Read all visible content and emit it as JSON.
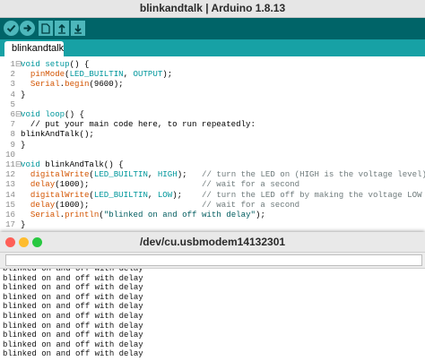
{
  "ide": {
    "title": "blinkandtalk | Arduino 1.8.13",
    "toolbar": {
      "verify_icon": "checkmark-icon",
      "upload_icon": "right-arrow-icon",
      "new_icon": "new-file-icon",
      "open_icon": "open-up-arrow-icon",
      "save_icon": "save-down-arrow-icon"
    },
    "tab_label": "blinkandtalk",
    "code_lines": [
      {
        "num": "1",
        "fold": "⊟",
        "tokens": [
          {
            "t": "void",
            "c": "kw"
          },
          {
            "t": " ",
            "c": "pl"
          },
          {
            "t": "setup",
            "c": "kw"
          },
          {
            "t": "() {",
            "c": "pl"
          }
        ]
      },
      {
        "num": "2",
        "fold": "",
        "tokens": [
          {
            "t": "  ",
            "c": "pl"
          },
          {
            "t": "pinMode",
            "c": "fn"
          },
          {
            "t": "(",
            "c": "pl"
          },
          {
            "t": "LED_BUILTIN",
            "c": "kw"
          },
          {
            "t": ", ",
            "c": "pl"
          },
          {
            "t": "OUTPUT",
            "c": "kw"
          },
          {
            "t": ");",
            "c": "pl"
          }
        ]
      },
      {
        "num": "3",
        "fold": "",
        "tokens": [
          {
            "t": "  ",
            "c": "pl"
          },
          {
            "t": "Serial",
            "c": "fn"
          },
          {
            "t": ".",
            "c": "pl"
          },
          {
            "t": "begin",
            "c": "fn"
          },
          {
            "t": "(9600);",
            "c": "pl"
          }
        ]
      },
      {
        "num": "4",
        "fold": "",
        "tokens": [
          {
            "t": "}",
            "c": "pl"
          }
        ]
      },
      {
        "num": "5",
        "fold": "",
        "tokens": []
      },
      {
        "num": "6",
        "fold": "⊟",
        "tokens": [
          {
            "t": "void",
            "c": "kw"
          },
          {
            "t": " ",
            "c": "pl"
          },
          {
            "t": "loop",
            "c": "kw"
          },
          {
            "t": "() {",
            "c": "pl"
          }
        ]
      },
      {
        "num": "7",
        "fold": "",
        "tokens": [
          {
            "t": "  // put your main code here, to run repeatedly:",
            "c": "pl"
          }
        ]
      },
      {
        "num": "8",
        "fold": "",
        "tokens": [
          {
            "t": "blinkAndTalk();",
            "c": "pl"
          }
        ]
      },
      {
        "num": "9",
        "fold": "",
        "tokens": [
          {
            "t": "}",
            "c": "pl"
          }
        ]
      },
      {
        "num": "10",
        "fold": "",
        "tokens": []
      },
      {
        "num": "11",
        "fold": "⊟",
        "tokens": [
          {
            "t": "void",
            "c": "kw"
          },
          {
            "t": " blinkAndTalk() {",
            "c": "pl"
          }
        ]
      },
      {
        "num": "12",
        "fold": "",
        "tokens": [
          {
            "t": "  ",
            "c": "pl"
          },
          {
            "t": "digitalWrite",
            "c": "fn"
          },
          {
            "t": "(",
            "c": "pl"
          },
          {
            "t": "LED_BUILTIN",
            "c": "kw"
          },
          {
            "t": ", ",
            "c": "pl"
          },
          {
            "t": "HIGH",
            "c": "kw"
          },
          {
            "t": ");   ",
            "c": "pl"
          },
          {
            "t": "// turn the LED on (HIGH is the voltage level)",
            "c": "cmt"
          }
        ]
      },
      {
        "num": "13",
        "fold": "",
        "tokens": [
          {
            "t": "  ",
            "c": "pl"
          },
          {
            "t": "delay",
            "c": "fn"
          },
          {
            "t": "(1000);                       ",
            "c": "pl"
          },
          {
            "t": "// wait for a second",
            "c": "cmt"
          }
        ]
      },
      {
        "num": "14",
        "fold": "",
        "tokens": [
          {
            "t": "  ",
            "c": "pl"
          },
          {
            "t": "digitalWrite",
            "c": "fn"
          },
          {
            "t": "(",
            "c": "pl"
          },
          {
            "t": "LED_BUILTIN",
            "c": "kw"
          },
          {
            "t": ", ",
            "c": "pl"
          },
          {
            "t": "LOW",
            "c": "kw"
          },
          {
            "t": ");    ",
            "c": "pl"
          },
          {
            "t": "// turn the LED off by making the voltage LOW",
            "c": "cmt"
          }
        ]
      },
      {
        "num": "15",
        "fold": "",
        "tokens": [
          {
            "t": "  ",
            "c": "pl"
          },
          {
            "t": "delay",
            "c": "fn"
          },
          {
            "t": "(1000);                       ",
            "c": "pl"
          },
          {
            "t": "// wait for a second",
            "c": "cmt"
          }
        ]
      },
      {
        "num": "16",
        "fold": "",
        "tokens": [
          {
            "t": "  ",
            "c": "pl"
          },
          {
            "t": "Serial",
            "c": "fn"
          },
          {
            "t": ".",
            "c": "pl"
          },
          {
            "t": "println",
            "c": "fn"
          },
          {
            "t": "(",
            "c": "pl"
          },
          {
            "t": "\"blinked on and off with delay\"",
            "c": "str"
          },
          {
            "t": ");",
            "c": "pl"
          }
        ]
      },
      {
        "num": "17",
        "fold": "",
        "tokens": [
          {
            "t": "}",
            "c": "pl"
          }
        ]
      }
    ]
  },
  "serial": {
    "title": "/dev/cu.usbmodem14132301",
    "input_value": "",
    "output_lines": [
      "blinked on and off with delay",
      "blinked on and off with delay",
      "blinked on and off with delay",
      "blinked on and off with delay",
      "blinked on and off with delay",
      "blinked on and off with delay",
      "blinked on and off with delay",
      "blinked on and off with delay",
      "blinked on and off with delay",
      "blinked on and off with delay"
    ]
  },
  "colors": {
    "toolbar_bg": "#006468",
    "tabbar_bg": "#17a1a5",
    "button_bg": "#4db7bb",
    "close_light": "#fe5f57",
    "minimize_light": "#febc2e",
    "zoom_light": "#28c840"
  }
}
